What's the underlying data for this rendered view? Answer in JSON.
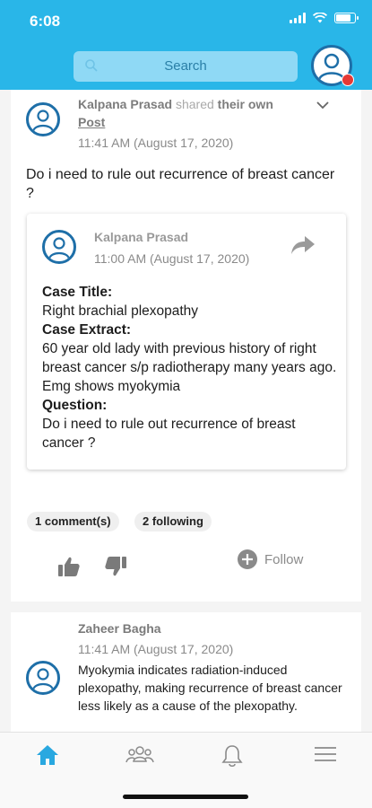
{
  "status_bar": {
    "time": "6:08"
  },
  "search": {
    "placeholder": "Search"
  },
  "post": {
    "author": "Kalpana Prasad",
    "shared_text": "shared",
    "own_text": "their own",
    "link_text": "Post",
    "timestamp": "11:41 AM (August 17, 2020)",
    "title": "Do i need to rule out recurrence of breast cancer ?",
    "shared_post": {
      "author": "Kalpana Prasad",
      "timestamp": "11:00 AM (August 17, 2020)",
      "case_title_label": "Case Title:",
      "case_title": "Right brachial plexopathy",
      "case_extract_label": "Case Extract:",
      "case_extract": "60 year old lady with previous history of right breast cancer s/p radiotherapy many years ago. Emg shows myokymia",
      "question_label": "Question:",
      "question": "Do i need to rule out recurrence of breast cancer ?"
    },
    "comments_count": "1 comment(s)",
    "following_count": "2 following",
    "follow_label": "Follow"
  },
  "comment": {
    "author": "Zaheer Bagha",
    "timestamp": "11:41 AM (August 17, 2020)",
    "text": "Myokymia indicates radiation-induced plexopathy, making recurrence of breast cancer less likely as a cause of the plexopathy."
  },
  "colors": {
    "header": "#29b6e8",
    "accent": "#29a8e0",
    "avatar_ring": "#1e6fa8"
  },
  "nav": {
    "items": [
      "home-icon",
      "group-icon",
      "bell-icon",
      "menu-icon"
    ]
  }
}
